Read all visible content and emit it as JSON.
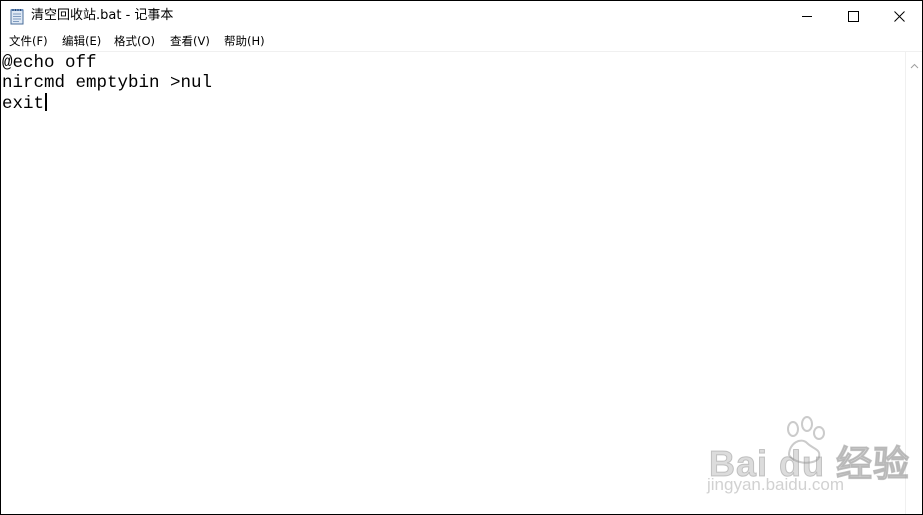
{
  "window": {
    "title": "清空回收站.bat - 记事本",
    "icon": "notepad-icon",
    "controls": {
      "minimize": "minimize-icon",
      "maximize": "maximize-icon",
      "close": "close-icon"
    }
  },
  "menu": {
    "items": [
      {
        "label": "文件(F)"
      },
      {
        "label": "编辑(E)"
      },
      {
        "label": "格式(O)"
      },
      {
        "label": "查看(V)"
      },
      {
        "label": "帮助(H)"
      }
    ]
  },
  "editor": {
    "lines": [
      "@echo off",
      "nircmd emptybin >nul",
      "exit"
    ]
  },
  "watermark": {
    "brand": "Bai du 经验",
    "url": "jingyan.baidu.com"
  },
  "colors": {
    "background": "#ffffff",
    "text": "#000000",
    "border": "#000000"
  }
}
